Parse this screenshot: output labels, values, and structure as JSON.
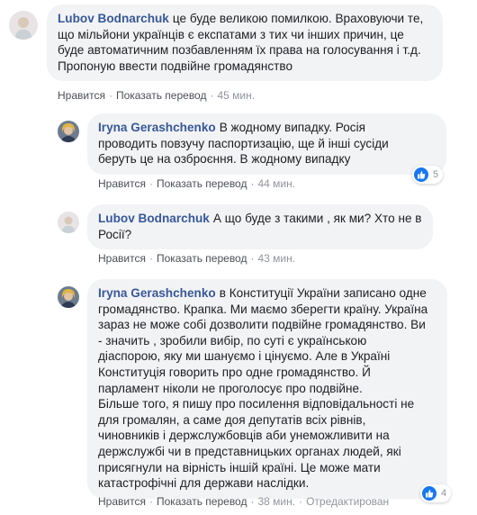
{
  "comments": [
    {
      "author": "Lubov Bodnarchuk",
      "lines": [
        "це буде великою помилкою. Враховуючи те,",
        "що мільйони українців є експатами з тих чи інших причин, це",
        "буде автоматичним позбавленням їх права на голосування і т.д.",
        "Пропоную ввести подвійне громадянство"
      ],
      "like_label": "Нравится",
      "translate_label": "Показать перевод",
      "time": "45 мин."
    },
    {
      "author": "Iryna Gerashchenko",
      "lines": [
        "В жодному випадку. Росія",
        "проводить повзучу паспортизацію, ще й інші сусіди",
        "беруть це на озброєння. В жодному випадку"
      ],
      "like_label": "Нравится",
      "translate_label": "Показать перевод",
      "time": "44 мин.",
      "reaction_count": "5"
    },
    {
      "author": "Lubov Bodnarchuk",
      "lines": [
        "А що буде з такими , як ми? Хто не в",
        "Росії?"
      ],
      "like_label": "Нравится",
      "translate_label": "Показать перевод",
      "time": "43 мин."
    },
    {
      "author": "Iryna Gerashchenko",
      "lines": [
        "в Конституції України записано одне",
        "громадянство. Крапка. Ми маємо зберегти країну. Україна",
        "зараз не може собі дозволити подвійне громадянство. Ви",
        "- значить , зробили вибір, по суті є українською",
        "діаспорою, яку ми шануємо і цінуємо. Але в Україні",
        "Конституція говорить про одне громадянство. Й",
        "парламент ніколи не проголосує про подвійне.",
        "Більше того, я пишу про посилення відповідальності не",
        "для громалян, а саме доя депутатів всіх рівнів,",
        "чиновників і держслужбовців аби унеможливити на",
        "держслужбі чи в представницьких органах людей, які",
        "присягнули на вірність іншій країні. Це може мати",
        "катастрофічні для держави наслідки."
      ],
      "like_label": "Нравится",
      "translate_label": "Показать перевод",
      "time": "38 мин.",
      "edited_label": "Отредактирован",
      "reaction_count": "4"
    }
  ],
  "colors": {
    "author": "#385898",
    "bubble": "#f2f3f5",
    "action": "#4b4f56",
    "meta": "#90949c",
    "like": "#1877f2"
  }
}
